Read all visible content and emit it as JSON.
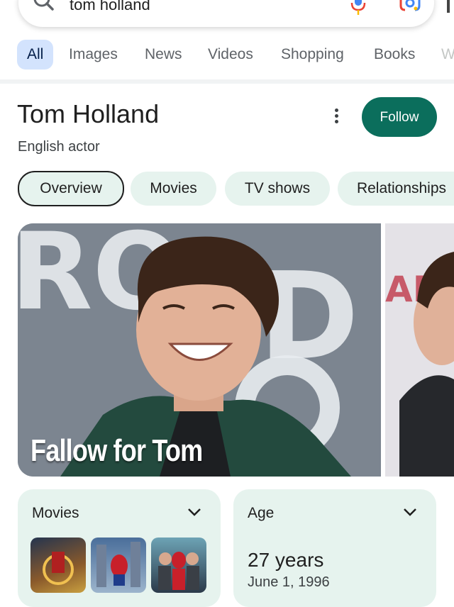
{
  "search": {
    "query": "tom holland"
  },
  "tabs": [
    {
      "label": "All",
      "active": true
    },
    {
      "label": "Images",
      "active": false
    },
    {
      "label": "News",
      "active": false
    },
    {
      "label": "Videos",
      "active": false
    },
    {
      "label": "Shopping",
      "active": false
    },
    {
      "label": "Books",
      "active": false
    },
    {
      "label": "W",
      "active": false
    }
  ],
  "entity": {
    "name": "Tom Holland",
    "description": "English actor",
    "follow_label": "Follow"
  },
  "chips": [
    {
      "label": "Overview",
      "active": true
    },
    {
      "label": "Movies",
      "active": false
    },
    {
      "label": "TV shows",
      "active": false
    },
    {
      "label": "Relationships",
      "active": false
    }
  ],
  "hero": {
    "caption": "Fallow for Tom"
  },
  "cards": {
    "movies": {
      "title": "Movies"
    },
    "age": {
      "title": "Age",
      "value": "27 years",
      "birth_date": "June 1, 1996"
    }
  },
  "colors": {
    "follow_bg": "#0b6e5c",
    "chip_bg": "#e6f3ee",
    "active_tab_bg": "#d3e3fd"
  }
}
